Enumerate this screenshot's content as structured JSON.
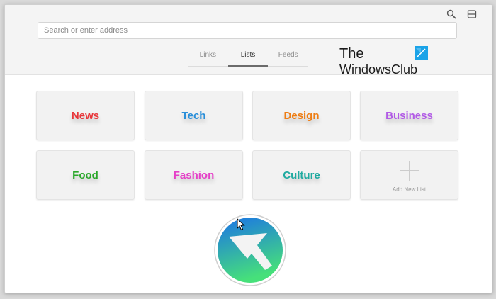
{
  "toolbar": {
    "search_icon": "search-icon",
    "layout_icon": "sidebar-layout-icon"
  },
  "address_bar": {
    "placeholder": "Search or enter address",
    "value": ""
  },
  "tabs": [
    {
      "label": "Links",
      "active": false
    },
    {
      "label": "Lists",
      "active": true
    },
    {
      "label": "Feeds",
      "active": false
    }
  ],
  "watermark": {
    "line1": "The",
    "line2": "WindowsClub"
  },
  "lists": [
    {
      "label": "News",
      "color": "#e8363a"
    },
    {
      "label": "Tech",
      "color": "#2a8fd9"
    },
    {
      "label": "Design",
      "color": "#ee7d14"
    },
    {
      "label": "Business",
      "color": "#b25be6"
    },
    {
      "label": "Food",
      "color": "#2aa82a"
    },
    {
      "label": "Fashion",
      "color": "#e640c8"
    },
    {
      "label": "Culture",
      "color": "#1faaa0"
    }
  ],
  "add_list": {
    "label": "Add New List",
    "icon": "plus-icon"
  },
  "colors": {
    "logo_gradient_top": "#1a72e8",
    "logo_gradient_bottom": "#46e07a",
    "accent_tab": "#6b6b6b"
  }
}
